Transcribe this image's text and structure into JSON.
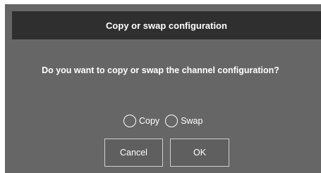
{
  "dialog": {
    "title": "Copy or swap configuration",
    "message": "Do you want to copy or swap the channel configuration?",
    "options": [
      {
        "label": "Copy",
        "selected": false
      },
      {
        "label": "Swap",
        "selected": false
      }
    ],
    "buttons": {
      "cancel_label": "Cancel",
      "ok_label": "OK"
    }
  },
  "colors": {
    "dialog_bg": "#666666",
    "titlebar_bg": "#2f2f2f",
    "text": "#ffffff",
    "button_border": "#d0d0d0"
  }
}
